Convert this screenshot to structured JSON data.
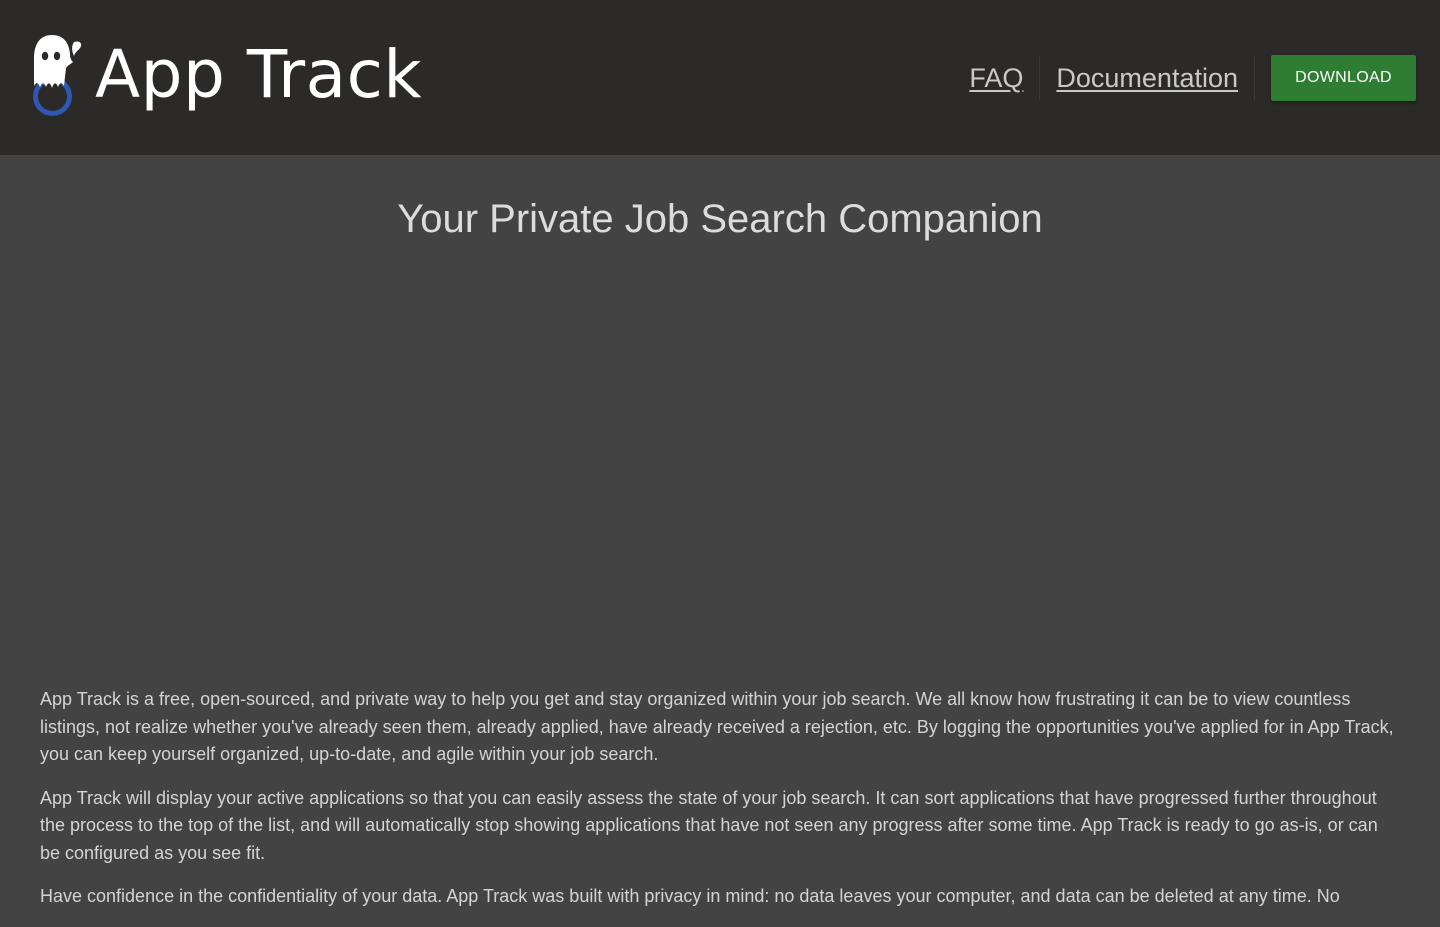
{
  "header": {
    "brand": "App Track",
    "logo_icon": "ghost-power-icon",
    "nav": {
      "faq": "FAQ",
      "documentation": "Documentation"
    },
    "download_label": "DOWNLOAD"
  },
  "hero": {
    "tagline": "Your Private Job Search Companion"
  },
  "content": {
    "paragraphs": [
      "App Track is a free, open-sourced, and private way to help you get and stay organized within your job search. We all know how frustrating it can be to view countless listings, not realize whether you've already seen them, already applied, have already received a rejection, etc. By logging the opportunities you've applied for in App Track, you can keep yourself organized, up-to-date, and agile within your job search.",
      "App Track will display your active applications so that you can easily assess the state of your job search. It can sort applications that have progressed further throughout the process to the top of the list, and will automatically stop showing applications that have not seen any progress after some time. App Track is ready to go as-is, or can be configured as you see fit.",
      "Have confidence in the confidentiality of your data. App Track was built with privacy in mind: no data leaves your computer, and data can be deleted at any time. No"
    ]
  },
  "colors": {
    "header_bg": "#2b2a29",
    "page_bg": "#434343",
    "download_bg": "#2e7d32",
    "logo_ring": "#2f57b5"
  }
}
